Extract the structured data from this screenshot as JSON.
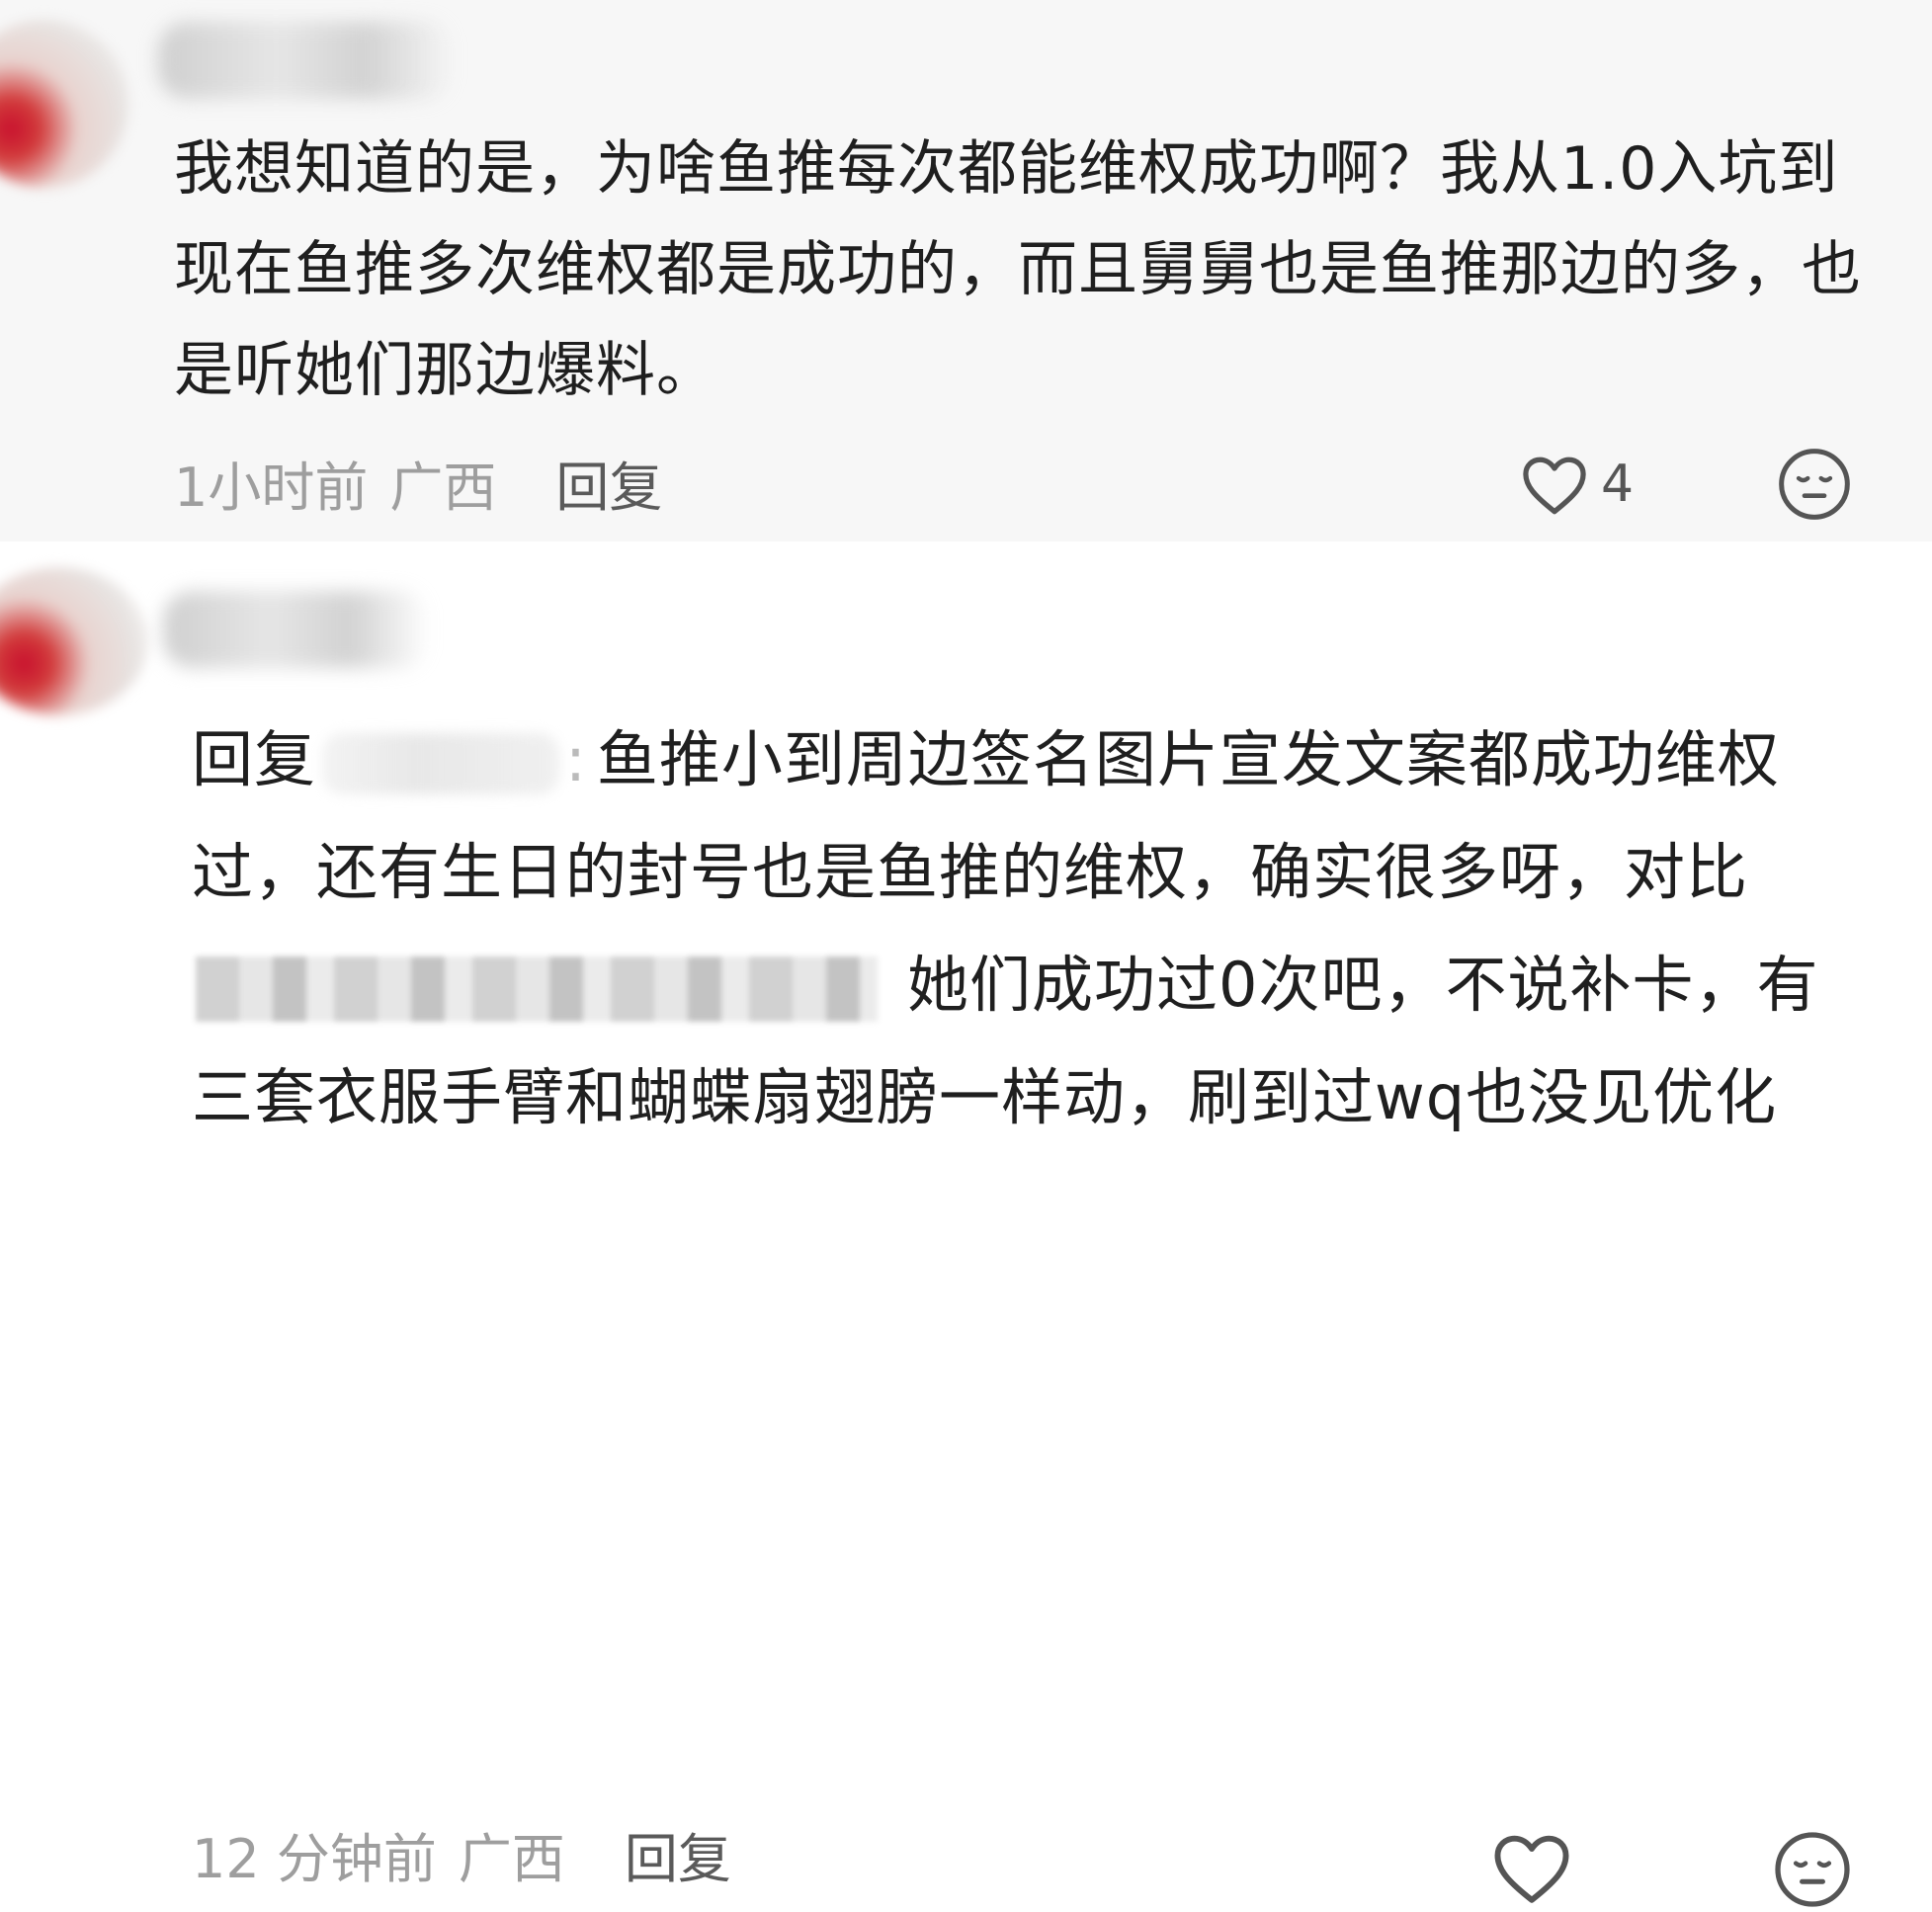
{
  "comments": [
    {
      "text": "我想知道的是，为啥鱼推每次都能维权成功啊？我从1.0入坑到现在鱼推多次维权都是成功的，而且舅舅也是鱼推那边的多，也是听她们那边爆料。",
      "time": "1小时前",
      "location": "广西",
      "reply_label": "回复",
      "like_count": "4",
      "like_icon": "heart-outline-icon",
      "dislike_icon": "unhappy-face-icon"
    },
    {
      "reply_prefix": "回复",
      "reply_colon": ":",
      "text_part1": "鱼推小到周边签名图片宣发文案都成功维权过，还有生日的封号也是鱼推的维权，确实很多呀，对比",
      "text_part2": "她们成功过0次吧，不说补卡，有三套衣服手臂和蝴蝶扇翅膀一样动，刷到过wq也没见优化",
      "time": "12 分钟前",
      "location": "广西",
      "reply_label": "回复",
      "like_icon": "heart-outline-icon",
      "dislike_icon": "unhappy-face-icon"
    }
  ],
  "colors": {
    "first_comment_bg": "#f7f7f7",
    "second_comment_bg": "#ffffff",
    "meta_text": "#9e9e9e",
    "body_text": "#1f1f1f"
  }
}
